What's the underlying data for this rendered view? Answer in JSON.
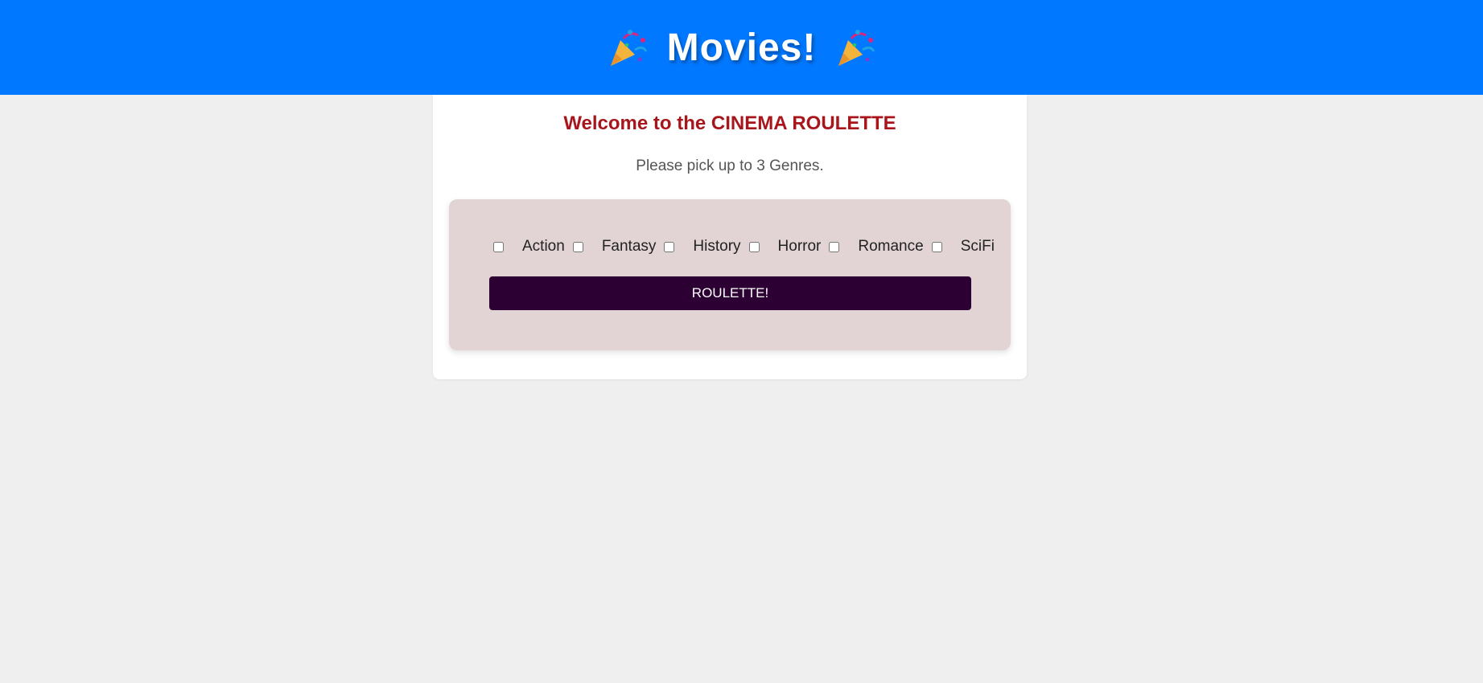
{
  "header": {
    "title": "Movies!",
    "left_icon": "party-popper-icon",
    "right_icon": "party-popper-icon",
    "background_color": "#0078ff"
  },
  "card": {
    "welcome": "Welcome to the CINEMA ROULETTE",
    "subtitle": "Please pick up to 3 Genres."
  },
  "genres": [
    {
      "label": "Action",
      "checked": false
    },
    {
      "label": "Fantasy",
      "checked": false
    },
    {
      "label": "History",
      "checked": false
    },
    {
      "label": "Horror",
      "checked": false
    },
    {
      "label": "Romance",
      "checked": false
    },
    {
      "label": "SciFi",
      "checked": false
    }
  ],
  "roulette_button": {
    "label": "ROULETTE!",
    "color": "#2d0034"
  },
  "colors": {
    "welcome_text": "#a8151b",
    "panel_background": "#e2d4d5",
    "page_background": "#efefef"
  }
}
